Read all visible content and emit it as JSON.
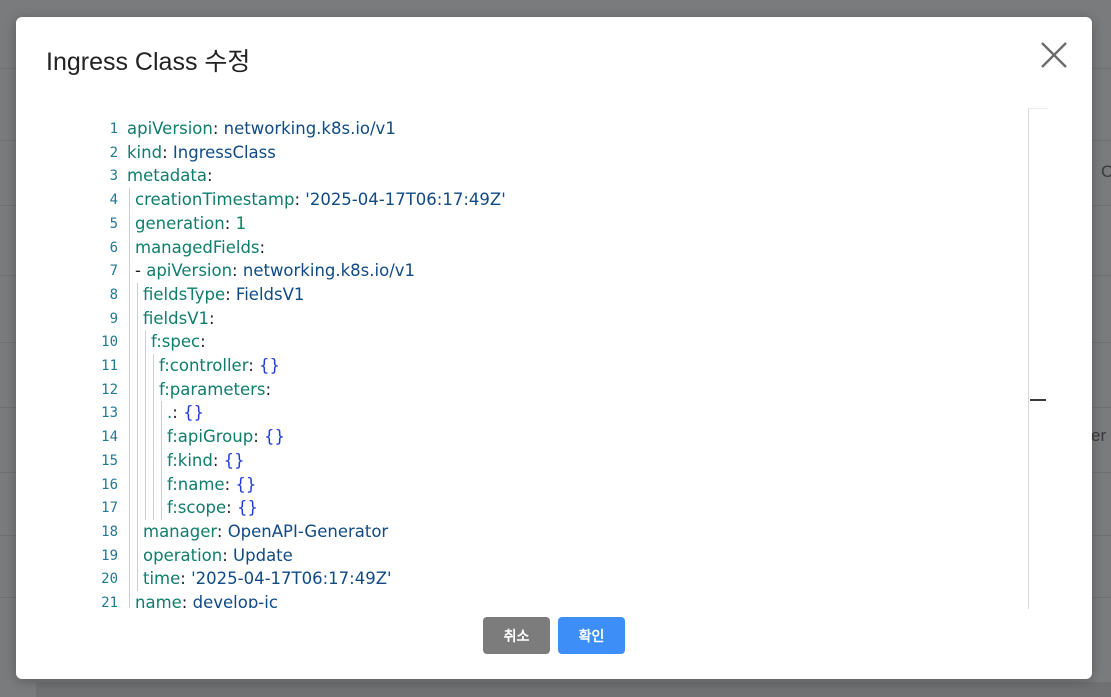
{
  "dialog": {
    "title": "Ingress Class 수정",
    "cancel_label": "취소",
    "confirm_label": "확인"
  },
  "background": {
    "right_partial_text": "er",
    "right_partial_c": "C"
  },
  "editor": {
    "lines": [
      {
        "num": "1",
        "indent": 0,
        "parts": [
          [
            "k",
            "apiVersion"
          ],
          [
            "p",
            ": "
          ],
          [
            "v",
            "networking.k8s.io/v1"
          ]
        ]
      },
      {
        "num": "2",
        "indent": 0,
        "parts": [
          [
            "k",
            "kind"
          ],
          [
            "p",
            ": "
          ],
          [
            "v",
            "IngressClass"
          ]
        ]
      },
      {
        "num": "3",
        "indent": 0,
        "parts": [
          [
            "k",
            "metadata"
          ],
          [
            "p",
            ":"
          ]
        ]
      },
      {
        "num": "4",
        "indent": 1,
        "parts": [
          [
            "k",
            "creationTimestamp"
          ],
          [
            "p",
            ": "
          ],
          [
            "v",
            "'2025-04-17T06:17:49Z'"
          ]
        ]
      },
      {
        "num": "5",
        "indent": 1,
        "parts": [
          [
            "k",
            "generation"
          ],
          [
            "p",
            ": "
          ],
          [
            "n",
            "1"
          ]
        ]
      },
      {
        "num": "6",
        "indent": 1,
        "parts": [
          [
            "k",
            "managedFields"
          ],
          [
            "p",
            ":"
          ]
        ]
      },
      {
        "num": "7",
        "indent": 1,
        "parts": [
          [
            "p",
            "- "
          ],
          [
            "k",
            "apiVersion"
          ],
          [
            "p",
            ": "
          ],
          [
            "v",
            "networking.k8s.io/v1"
          ]
        ]
      },
      {
        "num": "8",
        "indent": 2,
        "parts": [
          [
            "k",
            "fieldsType"
          ],
          [
            "p",
            ": "
          ],
          [
            "v",
            "FieldsV1"
          ]
        ]
      },
      {
        "num": "9",
        "indent": 2,
        "parts": [
          [
            "k",
            "fieldsV1"
          ],
          [
            "p",
            ":"
          ]
        ]
      },
      {
        "num": "10",
        "indent": 3,
        "parts": [
          [
            "k",
            "f:spec"
          ],
          [
            "p",
            ":"
          ]
        ]
      },
      {
        "num": "11",
        "indent": 4,
        "parts": [
          [
            "k",
            "f:controller"
          ],
          [
            "p",
            ": "
          ],
          [
            "b",
            "{}"
          ]
        ]
      },
      {
        "num": "12",
        "indent": 4,
        "parts": [
          [
            "k",
            "f:parameters"
          ],
          [
            "p",
            ":"
          ]
        ]
      },
      {
        "num": "13",
        "indent": 5,
        "parts": [
          [
            "k",
            "."
          ],
          [
            "p",
            ": "
          ],
          [
            "b",
            "{}"
          ]
        ]
      },
      {
        "num": "14",
        "indent": 5,
        "parts": [
          [
            "k",
            "f:apiGroup"
          ],
          [
            "p",
            ": "
          ],
          [
            "b",
            "{}"
          ]
        ]
      },
      {
        "num": "15",
        "indent": 5,
        "parts": [
          [
            "k",
            "f:kind"
          ],
          [
            "p",
            ": "
          ],
          [
            "b",
            "{}"
          ]
        ]
      },
      {
        "num": "16",
        "indent": 5,
        "parts": [
          [
            "k",
            "f:name"
          ],
          [
            "p",
            ": "
          ],
          [
            "b",
            "{}"
          ]
        ]
      },
      {
        "num": "17",
        "indent": 5,
        "parts": [
          [
            "k",
            "f:scope"
          ],
          [
            "p",
            ": "
          ],
          [
            "b",
            "{}"
          ]
        ]
      },
      {
        "num": "18",
        "indent": 2,
        "parts": [
          [
            "k",
            "manager"
          ],
          [
            "p",
            ": "
          ],
          [
            "v",
            "OpenAPI-Generator"
          ]
        ]
      },
      {
        "num": "19",
        "indent": 2,
        "parts": [
          [
            "k",
            "operation"
          ],
          [
            "p",
            ": "
          ],
          [
            "v",
            "Update"
          ]
        ]
      },
      {
        "num": "20",
        "indent": 2,
        "parts": [
          [
            "k",
            "time"
          ],
          [
            "p",
            ": "
          ],
          [
            "v",
            "'2025-04-17T06:17:49Z'"
          ]
        ]
      },
      {
        "num": "21",
        "indent": 1,
        "parts": [
          [
            "k",
            "name"
          ],
          [
            "p",
            ": "
          ],
          [
            "v",
            "develop-ic"
          ]
        ]
      }
    ]
  },
  "colors": {
    "key": "#0e7d6b",
    "value": "#0f4a85",
    "number": "#098658",
    "brace": "#1e3bd6",
    "confirm_button": "#3d8ef7",
    "cancel_button": "#7c7c7c"
  },
  "icons": {
    "close": "close-icon"
  }
}
